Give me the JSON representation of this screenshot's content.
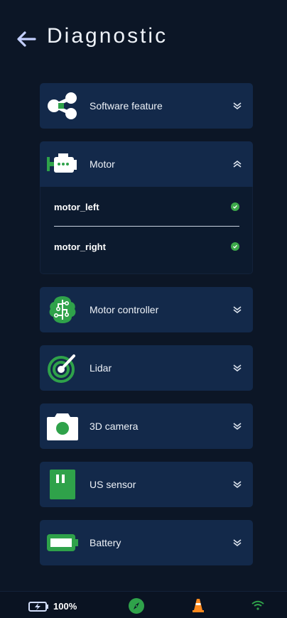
{
  "header": {
    "title": "Diagnostic"
  },
  "items": [
    {
      "label": "Software feature",
      "icon": "share-nodes-icon",
      "expanded": false
    },
    {
      "label": "Motor",
      "icon": "engine-icon",
      "expanded": true,
      "subitems": [
        {
          "name": "motor_left",
          "status": "ok"
        },
        {
          "name": "motor_right",
          "status": "ok"
        }
      ]
    },
    {
      "label": "Motor controller",
      "icon": "circuit-brain-icon",
      "expanded": false
    },
    {
      "label": "Lidar",
      "icon": "radar-icon",
      "expanded": false
    },
    {
      "label": "3D camera",
      "icon": "camera-icon",
      "expanded": false
    },
    {
      "label": "US sensor",
      "icon": "us-sensor-icon",
      "expanded": false
    },
    {
      "label": "Battery",
      "icon": "battery-icon",
      "expanded": false
    }
  ],
  "footer": {
    "battery_percent": "100%"
  },
  "colors": {
    "background": "#0c1626",
    "card": "#13294a",
    "accent_green": "#2fa24a",
    "cone_orange": "#ff8a1f",
    "back_arrow": "#b9c8ff"
  }
}
